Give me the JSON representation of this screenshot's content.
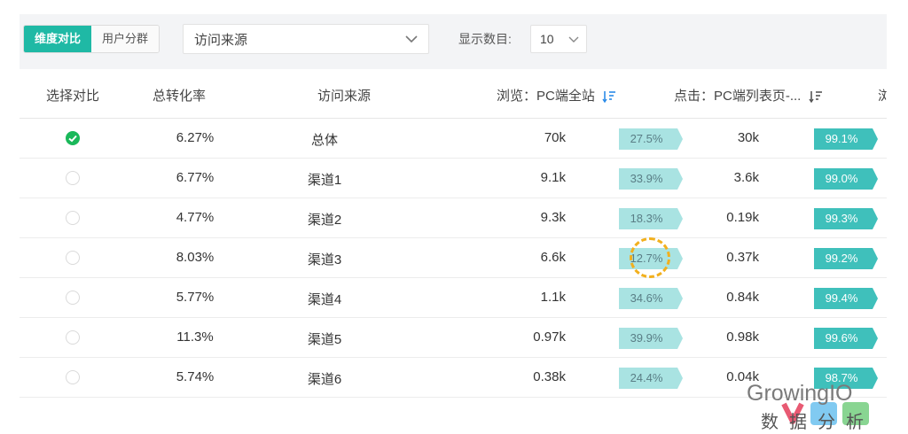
{
  "toolbar": {
    "tabs": [
      {
        "label": "维度对比",
        "active": true
      },
      {
        "label": "用户分群",
        "active": false
      }
    ],
    "source_select": {
      "value": "访问来源"
    },
    "count_label": "显示数目:",
    "count_select": {
      "value": "10"
    }
  },
  "table": {
    "columns": [
      "选择对比",
      "总转化率",
      "访问来源",
      "浏览：PC端全站",
      "点击：PC端列表页-...",
      "浏"
    ],
    "rows": [
      {
        "selected": true,
        "rate": "6.27%",
        "source": "总体",
        "views": "70k",
        "view_pct": "27.5%",
        "clicks": "30k",
        "click_pct": "99.1%"
      },
      {
        "selected": false,
        "rate": "6.77%",
        "source": "渠道1",
        "views": "9.1k",
        "view_pct": "33.9%",
        "clicks": "3.6k",
        "click_pct": "99.0%"
      },
      {
        "selected": false,
        "rate": "4.77%",
        "source": "渠道2",
        "views": "9.3k",
        "view_pct": "18.3%",
        "clicks": "0.19k",
        "click_pct": "99.3%"
      },
      {
        "selected": false,
        "rate": "8.03%",
        "source": "渠道3",
        "views": "6.6k",
        "view_pct": "12.7%",
        "clicks": "0.37k",
        "click_pct": "99.2%"
      },
      {
        "selected": false,
        "rate": "5.77%",
        "source": "渠道4",
        "views": "1.1k",
        "view_pct": "34.6%",
        "clicks": "0.84k",
        "click_pct": "99.4%"
      },
      {
        "selected": false,
        "rate": "11.3%",
        "source": "渠道5",
        "views": "0.97k",
        "view_pct": "39.9%",
        "clicks": "0.98k",
        "click_pct": "99.6%"
      },
      {
        "selected": false,
        "rate": "5.74%",
        "source": "渠道6",
        "views": "0.38k",
        "view_pct": "24.4%",
        "clicks": "0.04k",
        "click_pct": "98.7%"
      }
    ]
  },
  "colors": {
    "accent": "#1fb9a5",
    "check": "#1ab85a",
    "view_pill": "#a9e3e2",
    "click_pill": "#3fc0bb",
    "highlight": "#f2b01e"
  },
  "icons": {
    "chevron": "chevron-down-icon",
    "sort": "sort-desc-icon",
    "check": "check-circle-icon"
  },
  "watermark": {
    "brand": "GrowingIO",
    "subtitle": "数据分析"
  }
}
